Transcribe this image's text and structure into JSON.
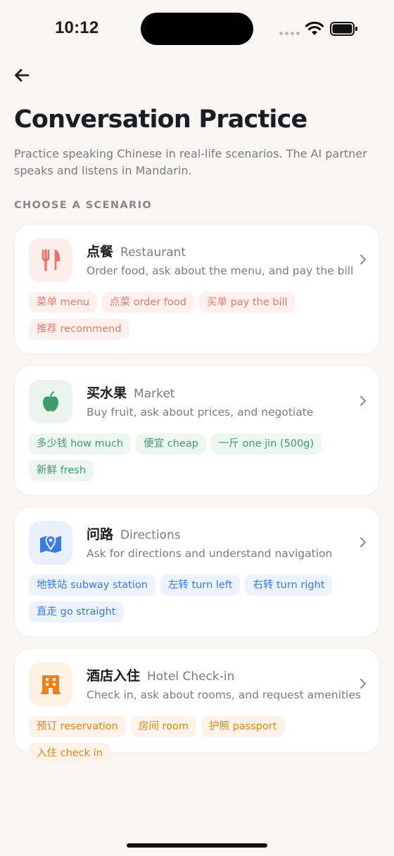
{
  "status_bar": {
    "time": "10:12"
  },
  "header": {
    "title": "Conversation Practice",
    "subtitle": "Practice speaking Chinese in real-life scenarios. The AI partner speaks and listens in Mandarin."
  },
  "section_label": "CHOOSE A SCENARIO",
  "scenarios": [
    {
      "zh": "点餐",
      "en": "Restaurant",
      "desc": "Order food, ask about the menu, and pay the bill",
      "icon": "fork-knife-icon",
      "accent": "#e8736a",
      "icon_bg": "#fdeeec",
      "tag_bg": "#fdf1ef",
      "tag_color": "#e27b6f",
      "tags": [
        "菜单 menu",
        "点菜 order food",
        "买单 pay the bill",
        "推荐 recommend"
      ]
    },
    {
      "zh": "买水果",
      "en": "Market",
      "desc": "Buy fruit, ask about prices, and negotiate",
      "icon": "apple-icon",
      "accent": "#3f9a6b",
      "icon_bg": "#e9f4ee",
      "tag_bg": "#edf6f0",
      "tag_color": "#3f9a6b",
      "tags": [
        "多少钱 how much",
        "便宜 cheap",
        "一斤 one jin (500g)",
        "新鲜 fresh"
      ]
    },
    {
      "zh": "问路",
      "en": "Directions",
      "desc": "Ask for directions and understand navigation",
      "icon": "map-pin-icon",
      "accent": "#3b7ae0",
      "icon_bg": "#e9f0fc",
      "tag_bg": "#edf3fd",
      "tag_color": "#3b7ae0",
      "tags": [
        "地铁站 subway station",
        "左转 turn left",
        "右转 turn right",
        "直走 go straight"
      ]
    },
    {
      "zh": "酒店入住",
      "en": "Hotel Check-in",
      "desc": "Check in, ask about rooms, and request amenities",
      "icon": "hotel-icon",
      "accent": "#e8821e",
      "icon_bg": "#fdf1e4",
      "tag_bg": "#fdf3e8",
      "tag_color": "#e0841f",
      "tags": [
        "预订 reservation",
        "房间 room",
        "护照 passport",
        "入住 check in"
      ]
    }
  ]
}
